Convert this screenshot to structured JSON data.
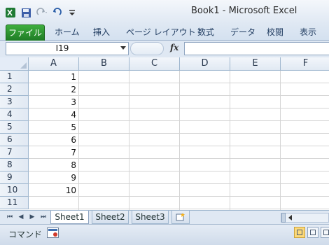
{
  "window": {
    "title": "Book1 - Microsoft Excel"
  },
  "qat": {
    "icons": [
      "excel-logo-icon",
      "save-icon",
      "redo-icon",
      "undo-icon",
      "customize-qat-icon"
    ]
  },
  "ribbon": {
    "tabs": [
      {
        "label": "ファイル"
      },
      {
        "label": "ホーム"
      },
      {
        "label": "挿入"
      },
      {
        "label": "ページ レイアウト"
      },
      {
        "label": "数式"
      },
      {
        "label": "データ"
      },
      {
        "label": "校閲"
      },
      {
        "label": "表示"
      }
    ]
  },
  "formula_bar": {
    "name_box": "I19",
    "fx_label": "fx",
    "value": ""
  },
  "grid": {
    "columns": [
      "A",
      "B",
      "C",
      "D",
      "E",
      "F"
    ],
    "rows": [
      "1",
      "2",
      "3",
      "4",
      "5",
      "6",
      "7",
      "8",
      "9",
      "10",
      "11"
    ],
    "column_a_values": [
      "1",
      "2",
      "3",
      "4",
      "5",
      "6",
      "7",
      "8",
      "9",
      "10"
    ]
  },
  "sheet_tabs": {
    "active": "Sheet1",
    "tabs": [
      "Sheet1",
      "Sheet2",
      "Sheet3"
    ],
    "nav": [
      "⏮",
      "◀",
      "▶",
      "⏭"
    ]
  },
  "status_bar": {
    "mode": "コマンド"
  },
  "colors": {
    "file_tab": "#1e7b25",
    "ribbon_bg": "#dfe8f3",
    "header_bg": "#e1e9f3",
    "gridline": "#d4d4d4"
  }
}
